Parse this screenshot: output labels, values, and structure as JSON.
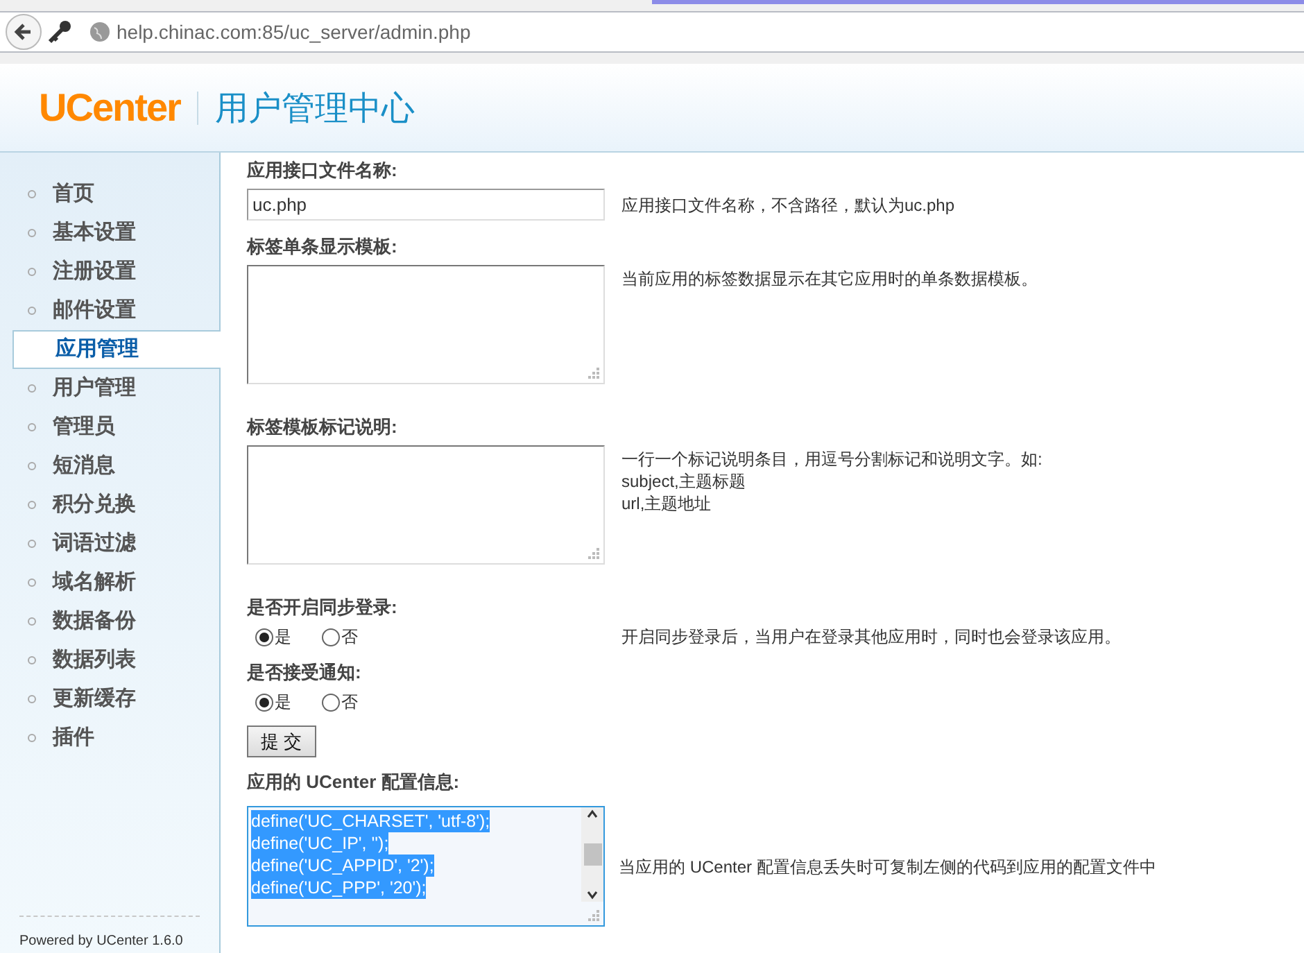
{
  "browser": {
    "url": "help.chinac.com:85/uc_server/admin.php"
  },
  "header": {
    "logo": "UCenter",
    "title": "用户管理中心"
  },
  "sidebar": {
    "items": [
      {
        "label": "首页",
        "selected": false
      },
      {
        "label": "基本设置",
        "selected": false
      },
      {
        "label": "注册设置",
        "selected": false
      },
      {
        "label": "邮件设置",
        "selected": false
      },
      {
        "label": "应用管理",
        "selected": true
      },
      {
        "label": "用户管理",
        "selected": false
      },
      {
        "label": "管理员",
        "selected": false
      },
      {
        "label": "短消息",
        "selected": false
      },
      {
        "label": "积分兑换",
        "selected": false
      },
      {
        "label": "词语过滤",
        "selected": false
      },
      {
        "label": "域名解析",
        "selected": false
      },
      {
        "label": "数据备份",
        "selected": false
      },
      {
        "label": "数据列表",
        "selected": false
      },
      {
        "label": "更新缓存",
        "selected": false
      },
      {
        "label": "插件",
        "selected": false
      }
    ],
    "footer": "Powered by UCenter 1.6.0"
  },
  "form": [
    {
      "kind": "text",
      "label": "应用接口文件名称:",
      "value": "uc.php",
      "help": [
        "应用接口文件名称，不含路径，默认为uc.php"
      ]
    },
    {
      "kind": "textarea",
      "label": "标签单条显示模板:",
      "help": [
        "当前应用的标签数据显示在其它应用时的单条数据模板。"
      ]
    },
    {
      "kind": "textarea",
      "label": "标签模板标记说明:",
      "help": [
        "一行一个标记说明条目，用逗号分割标记和说明文字。如:",
        "subject,主题标题",
        "url,主题地址"
      ]
    },
    {
      "kind": "radio",
      "label": "是否开启同步登录:",
      "options": [
        {
          "label": "是",
          "selected": true
        },
        {
          "label": "否",
          "selected": false
        }
      ],
      "help": [
        "开启同步登录后，当用户在登录其他应用时，同时也会登录该应用。"
      ]
    },
    {
      "kind": "radio",
      "label": "是否接受通知:",
      "options": [
        {
          "label": "是",
          "selected": true
        },
        {
          "label": "否",
          "selected": false
        }
      ]
    },
    {
      "kind": "submit",
      "label": "提 交"
    },
    {
      "kind": "code",
      "label": "应用的 UCenter 配置信息:",
      "lines": [
        "define('UC_CHARSET', 'utf-8');",
        "define('UC_IP', '');",
        "define('UC_APPID', '2');",
        "define('UC_PPP', '20');"
      ],
      "help": [
        "当应用的 UCenter 配置信息丢失时可复制左侧的代码到应用的配置文件中"
      ]
    }
  ]
}
